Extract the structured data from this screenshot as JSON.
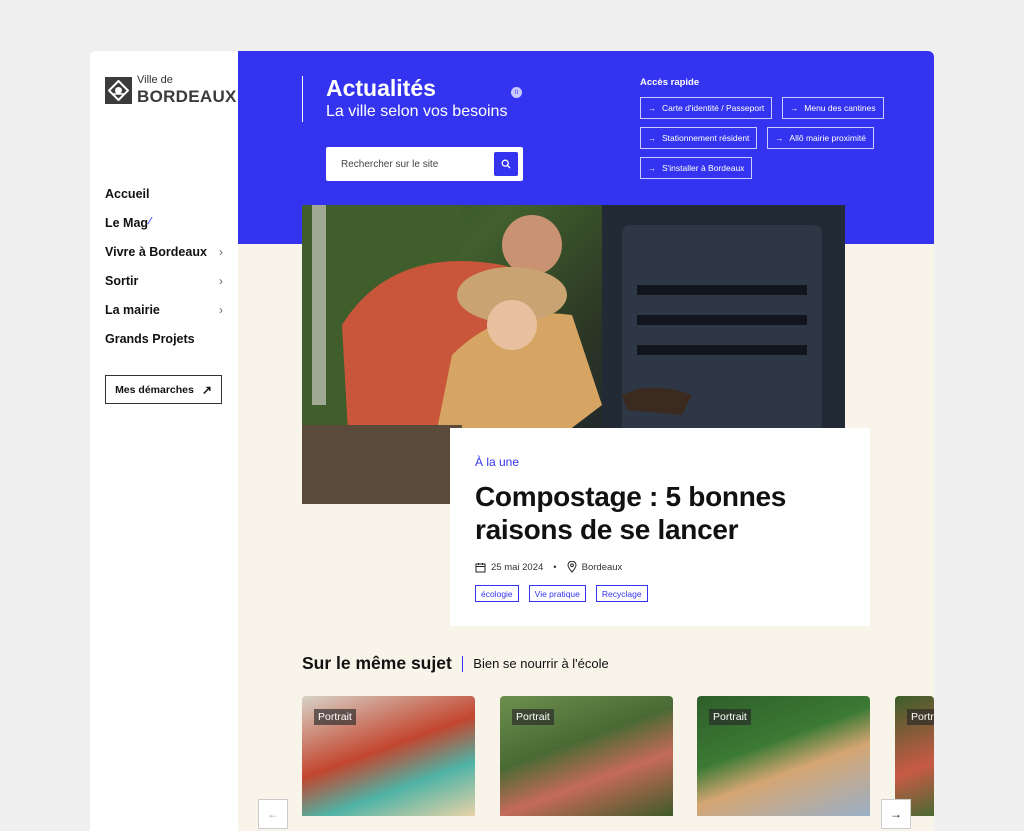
{
  "logo": {
    "line1": "Ville de",
    "line2": "BORDEAUX"
  },
  "nav": {
    "items": [
      {
        "label": "Accueil",
        "chevron": false
      },
      {
        "label": "Le Mag",
        "chevron": false,
        "sparkle": true
      },
      {
        "label": "Vivre à Bordeaux",
        "chevron": true
      },
      {
        "label": "Sortir",
        "chevron": true
      },
      {
        "label": "La mairie",
        "chevron": true
      },
      {
        "label": "Grands Projets",
        "chevron": false
      }
    ],
    "demarches_label": "Mes démarches"
  },
  "header": {
    "title": "Actualités",
    "subtitle": "La ville selon vos besoins",
    "search_placeholder": "Rechercher sur le site",
    "quick_title": "Accès rapide",
    "quick_links": [
      "Carte d'identité / Passeport",
      "Menu des cantines",
      "Stationnement résident",
      "Allô mairie proximité",
      "S'installer à Bordeaux"
    ]
  },
  "hero": {
    "kicker": "À la une",
    "title": "Compostage : 5 bonnes raisons de se lancer",
    "date": "25 mai 2024",
    "location": "Bordeaux",
    "tags": [
      "écologie",
      "Vie pratique",
      "Recyclage"
    ]
  },
  "related": {
    "title": "Sur le même sujet",
    "subtitle": "Bien se nourrir à l'école",
    "cards": [
      {
        "badge": "Portrait"
      },
      {
        "badge": "Portrait"
      },
      {
        "badge": "Portrait"
      },
      {
        "badge": "Portrait"
      }
    ]
  },
  "colors": {
    "accent": "#3434f0",
    "background": "#f8f4ea",
    "page": "#efeff0"
  }
}
